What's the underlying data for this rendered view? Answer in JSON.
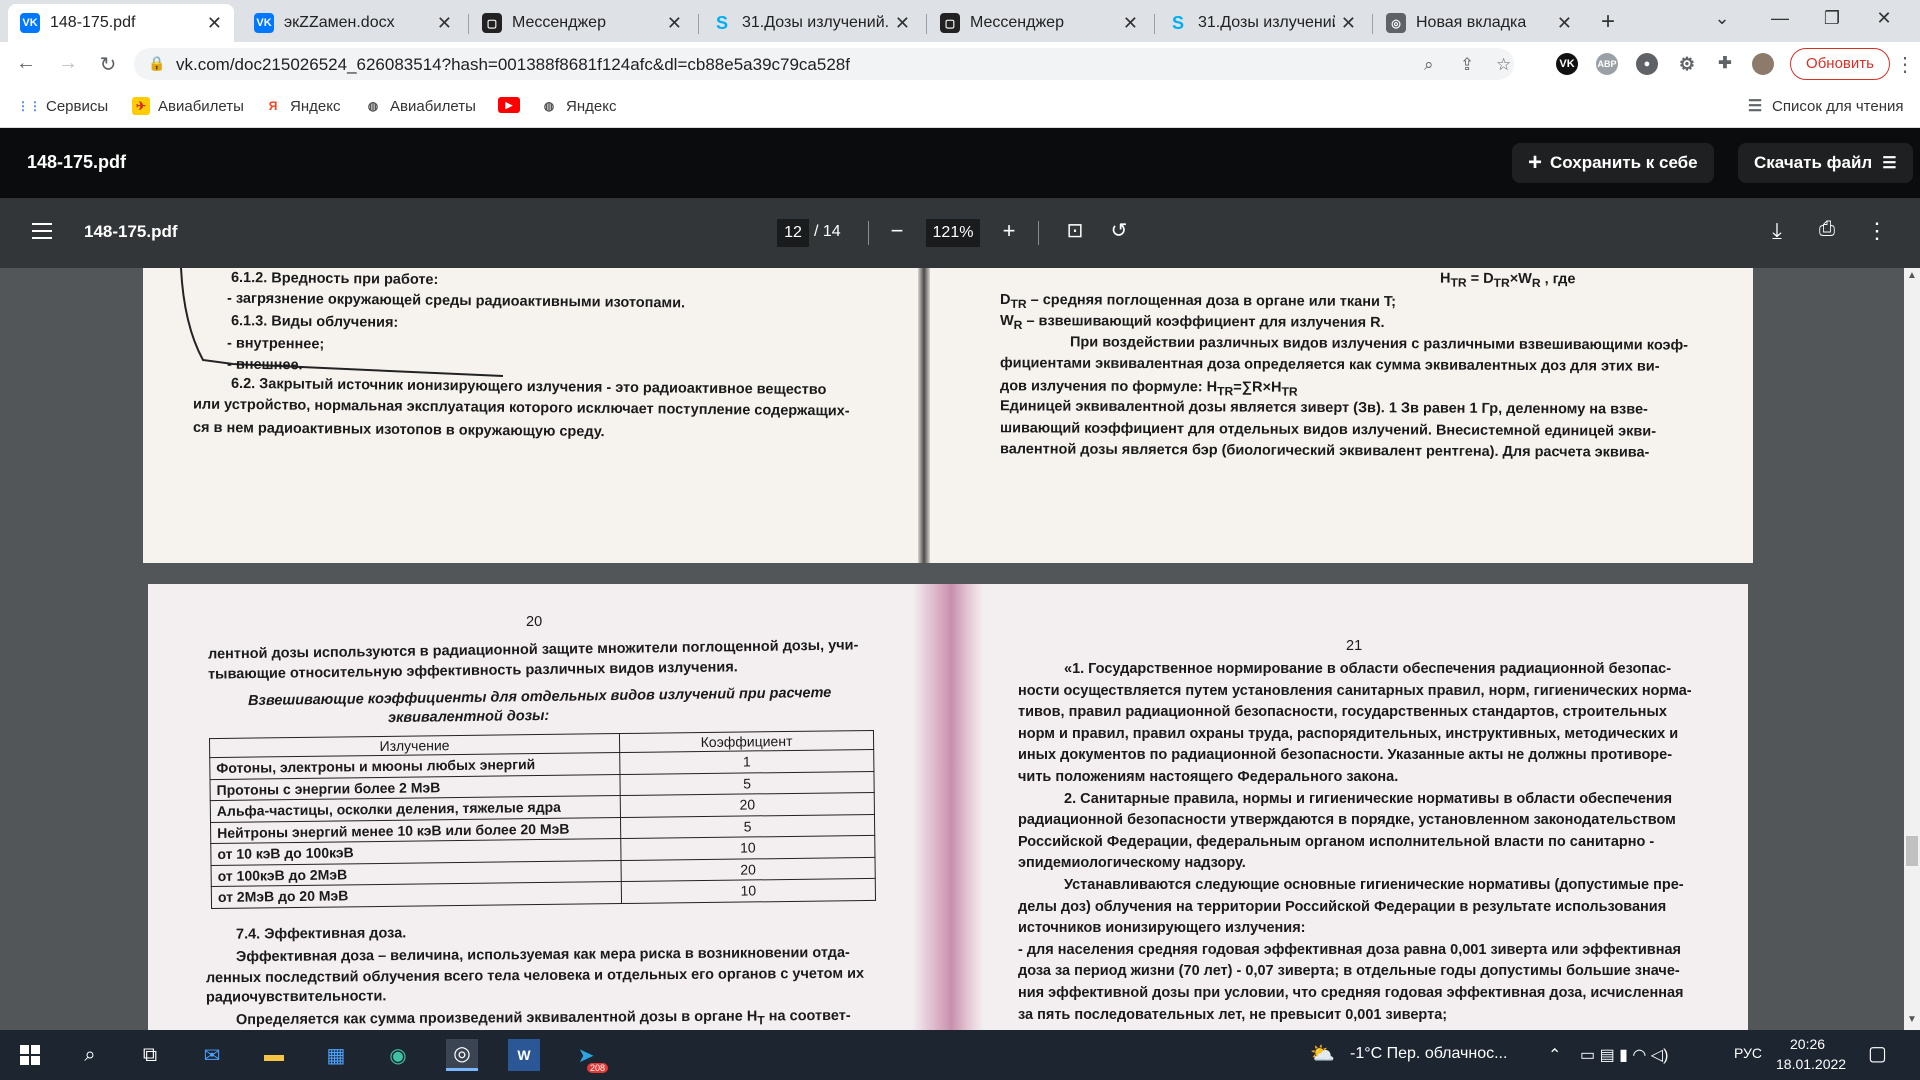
{
  "tabs": [
    {
      "title": "148-175.pdf",
      "active": true,
      "icon": "vk-icon"
    },
    {
      "title": "экZZамен.docx",
      "icon": "vk-icon"
    },
    {
      "title": "Мессенджер",
      "icon": "messenger-icon"
    },
    {
      "title": "31.Дозы излучений.",
      "icon": "skype-icon"
    },
    {
      "title": "Мессенджер",
      "icon": "messenger-icon"
    },
    {
      "title": "31.Дозы излучений.",
      "icon": "skype-icon"
    },
    {
      "title": "Новая вкладка",
      "icon": "chrome-icon"
    }
  ],
  "address": {
    "url": "vk.com/doc215026524_626083514?hash=001388f8681f124afc&dl=cb88e5a39c79ca528f",
    "update_label": "Обновить"
  },
  "bookmarks": [
    {
      "label": "Сервисы",
      "icon": "apps-grid-icon"
    },
    {
      "label": "Авиабилеты",
      "icon": "avia-icon"
    },
    {
      "label": "Яндекс",
      "icon": "yandex-icon"
    },
    {
      "label": "Авиабилеты",
      "icon": "globe-icon"
    },
    {
      "label": "",
      "icon": "youtube-icon"
    },
    {
      "label": "Яндекс",
      "icon": "globe-icon"
    }
  ],
  "reading_list": "Список для чтения",
  "vk": {
    "filename": "148-175.pdf",
    "save_label": "Сохранить к себе",
    "download_label": "Скачать файл"
  },
  "pdf": {
    "filename": "148-175.pdf",
    "page": "12",
    "total": "/ 14",
    "zoom": "121%"
  },
  "page_top_left": [
    "6.1.2.  Вредность при работе:",
    "- загрязнение окружающей среды радиоактивными изотопами.",
    "6.1.3. Виды облучения:",
    "- внутреннее;",
    "- внешнее.",
    "6.2. Закрытый источник ионизирующего излучения - это радиоактивное вещество",
    "или  устройство, нормальная эксплуатация которого исключает поступление  содержащих-",
    "ся в нем радиоактивных изотопов в  окружающую среду."
  ],
  "page_top_right": [
    "H<sub>TR</sub> = D<sub>TR</sub>×W<sub>R</sub> , где",
    "D<sub>TR</sub> – средняя поглощенная доза в органе или ткани T;",
    "W<sub>R</sub> – взвешивающий коэффициент для излучения R.",
    "При воздействии различных видов излучения с различными взвешивающими коэф-",
    "фициентами эквивалентная доза определяется как сумма эквивалентных доз для этих ви-",
    "дов излучения по формуле: H<sub>TR</sub>=∑R×H<sub>TR</sub>",
    "Единицей эквивалентной дозы является зиверт (Зв).  1 Зв равен 1 Гр, деленному на взве-",
    "шивающий коэффициент для отдельных видов излучений.  Внесистемной единицей экви-",
    "валентной дозы является бэр (биологический эквивалент рентгена).  Для расчета эквива-"
  ],
  "page2_left_number": "20",
  "page2_left_intro": [
    "лентной дозы используются в радиационной защите множители поглощенной дозы, учи-",
    "тывающие относительную эффективность различных видов излучения."
  ],
  "table_caption": [
    "Взвешивающие коэффициенты для отдельных видов излучений при расчете",
    "эквивалентной дозы:"
  ],
  "table": {
    "headers": [
      "Излучение",
      "Коэффициент"
    ],
    "rows": [
      [
        "Фотоны, электроны  и мюоны  любых энергий",
        "1"
      ],
      [
        "Протоны   с энергии более 2 МэВ",
        "5"
      ],
      [
        "Альфа-частицы, осколки деления, тяжелые ядра",
        "20"
      ],
      [
        "Нейтроны энергий менее 10 кэВ или более 20 МэВ",
        "5"
      ],
      [
        "от 10 кэВ до 100кэВ",
        "10"
      ],
      [
        "от 100кэВ до 2МэВ",
        "20"
      ],
      [
        "от 2МэВ до 20 МэВ",
        "10"
      ]
    ]
  },
  "page2_left_after": [
    "7.4.  Эффективная доза.",
    "Эффективная доза – величина, используемая как мера риска в возникновении отда-",
    "ленных последствий  облучения всего тела человека и отдельных его органов с учетом их",
    "радиочувствительности.",
    "Определяется как сумма произведений эквивалентной дозы в органе H<sub>T</sub> на соответ-"
  ],
  "page2_right_number": "21",
  "page2_right": [
    "«1. Государственное нормирование в области обеспечения радиационной безопас-",
    "ности осуществляется путем установления санитарных правил, норм, гигиенических норма-",
    "тивов, правил радиационной безопасности, государственных стандартов, строительных",
    "норм и правил, правил охраны труда, распорядительных, инструктивных, методических и",
    "иных документов по радиационной безопасности. Указанные акты не должны противоре-",
    "чить положениям настоящего Федерального закона.",
    "2. Санитарные правила, нормы и гигиенические нормативы в области обеспечения",
    "радиационной безопасности утверждаются в порядке, установленном законодательством",
    "Российской Федерации, федеральным органом исполнительной власти по санитарно -",
    "эпидемиологическому надзору.",
    "Устанавливаются следующие основные гигиенические нормативы (допустимые пре-",
    "делы доз) облучения на территории Российской Федерации в результате использования",
    "источников ионизирующего излучения:",
    "- для населения средняя годовая эффективная доза равна 0,001 зиверта или эффективная",
    "доза за период жизни (70 лет) - 0,07 зиверта; в отдельные годы допустимы большие значе-",
    "ния эффективной дозы при условии, что средняя годовая эффективная доза, исчисленная",
    "за пять последовательных лет, не превысит 0,001 зиверта;"
  ],
  "taskbar": {
    "weather": "-1°C  Пер. облачнос...",
    "lang": "РУС",
    "time": "20:26",
    "date": "18.01.2022",
    "telegram_badge": "208"
  }
}
